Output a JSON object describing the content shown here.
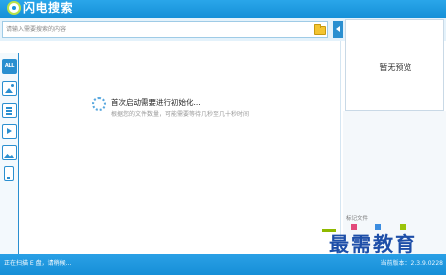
{
  "app": {
    "title": "闪电搜索"
  },
  "search": {
    "placeholder": "请输入需要搜索的内容"
  },
  "sidebar": {
    "items": [
      {
        "label": "ALL",
        "icon": "all-icon"
      },
      {
        "icon": "image-icon"
      },
      {
        "icon": "document-icon"
      },
      {
        "icon": "video-icon"
      },
      {
        "icon": "photo-icon"
      },
      {
        "icon": "mobile-icon"
      }
    ]
  },
  "main": {
    "init_title": "首次启动需要进行初始化...",
    "init_subtitle": "根据您的文件数量，可能需要等待几秒至几十秒时间"
  },
  "preview": {
    "empty_text": "暂无预览",
    "mark_file_label": "标记文件"
  },
  "status": {
    "scanning_text": "正在扫描 E 盘，请稍候...",
    "version_text": "当前版本：2.3.9.0228"
  },
  "watermark": {
    "text": "最需教育"
  },
  "colors": {
    "accent": "#1a93db",
    "title_bar": "#2aa6ea",
    "folder": "#f3c431",
    "watermark": "#1d4ea8"
  }
}
